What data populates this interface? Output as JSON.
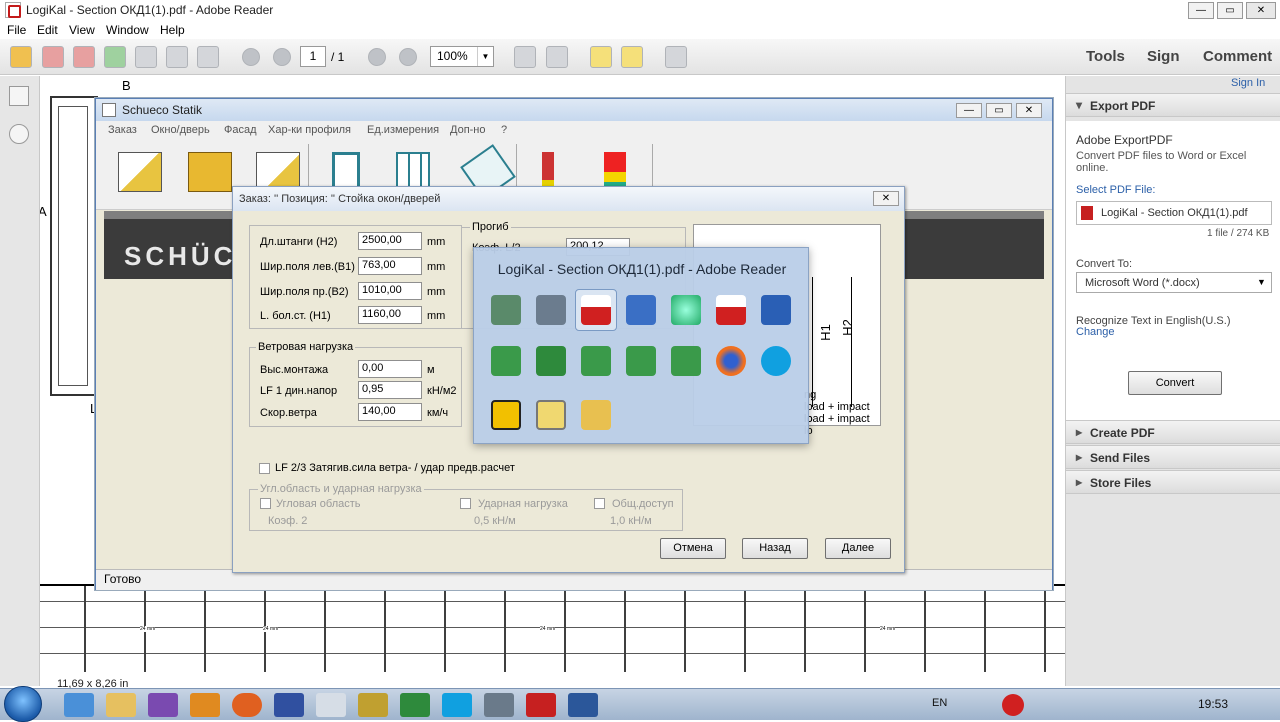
{
  "app": {
    "title": "LogiKal - Section ОКД1(1).pdf - Adobe Reader"
  },
  "menu": [
    "File",
    "Edit",
    "View",
    "Window",
    "Help"
  ],
  "toolbar": {
    "page": "1",
    "page_of": "/ 1",
    "zoom": "100%",
    "tools": "Tools",
    "sign": "Sign",
    "comment": "Comment"
  },
  "right_pane": {
    "sign_in": "Sign In",
    "export_title": "Export PDF",
    "adobe_export": "Adobe ExportPDF",
    "desc": "Convert PDF files to Word or Excel online.",
    "select_label": "Select PDF File:",
    "file_name": "LogiKal - Section ОКД1(1).pdf",
    "file_info": "1 file / 274 KB",
    "convert_to": "Convert To:",
    "format": "Microsoft Word (*.docx)",
    "recognize": "Recognize Text in English(U.S.)",
    "change": "Change",
    "convert_btn": "Convert",
    "create_pdf": "Create PDF",
    "send_files": "Send Files",
    "store_files": "Store Files"
  },
  "doc": {
    "size": "11,69 x 8,26 in",
    "letter_b": "B",
    "letter_a": "A",
    "letter_l": "L",
    "label_24": "24 mm"
  },
  "schueco": {
    "title": "Schueco Statik",
    "menu": [
      "Заказ",
      "Окно/дверь",
      "Фасад",
      "Хар-ки профиля",
      "Ед.измерения",
      "Доп-но",
      "?"
    ],
    "logo": "SCHÜCO",
    "status": "Готово"
  },
  "dialog": {
    "title": "Заказ: ''   Позиция: ''   Стойка окон/дверей",
    "fields": [
      {
        "label": "Дл.штанги (H2)",
        "value": "2500,00",
        "unit": "mm"
      },
      {
        "label": "Шир.поля лев.(B1)",
        "value": "763,00",
        "unit": "mm"
      },
      {
        "label": "Шир.поля пр.(B2)",
        "value": "1010,00",
        "unit": "mm"
      },
      {
        "label": "L. бол.ст. (H1)",
        "value": "1160,00",
        "unit": "mm"
      }
    ],
    "progib": "Прогиб",
    "koef": "Коэф. L/2",
    "koef_val": "200,12",
    "wind_group": "Ветровая нагрузка",
    "wind": [
      {
        "label": "Выс.монтажа",
        "value": "0,00",
        "unit": "м"
      },
      {
        "label": "LF 1 дин.напор",
        "value": "0,95",
        "unit": "кН/м2"
      },
      {
        "label": "Скор.ветра",
        "value": "140,00",
        "unit": "км/ч"
      }
    ],
    "lf23": "LF 2/3  Затягив.сила ветра- / удар предв.расчет",
    "corner_group": "Угл.область и ударная нагрузка",
    "corner": "Угловая область",
    "impact": "Ударная нагрузка",
    "access": "Общ.доступ",
    "koef2": "Коэф. 2",
    "kn1": "0,5 кН/м",
    "kn2": "1,0 кН/м",
    "cancel": "Отмена",
    "back": "Назад",
    "next": "Далее",
    "preview_h1": "H1",
    "preview_h2": "H2",
    "preview_line1": "ng",
    "preview_line2": "load + impact lo",
    "preview_line3": "load + impact lo"
  },
  "switcher": {
    "title": "LogiKal - Section ОКД1(1).pdf - Adobe Reader"
  },
  "taskbar": {
    "lang": "EN",
    "time": "19:53"
  }
}
